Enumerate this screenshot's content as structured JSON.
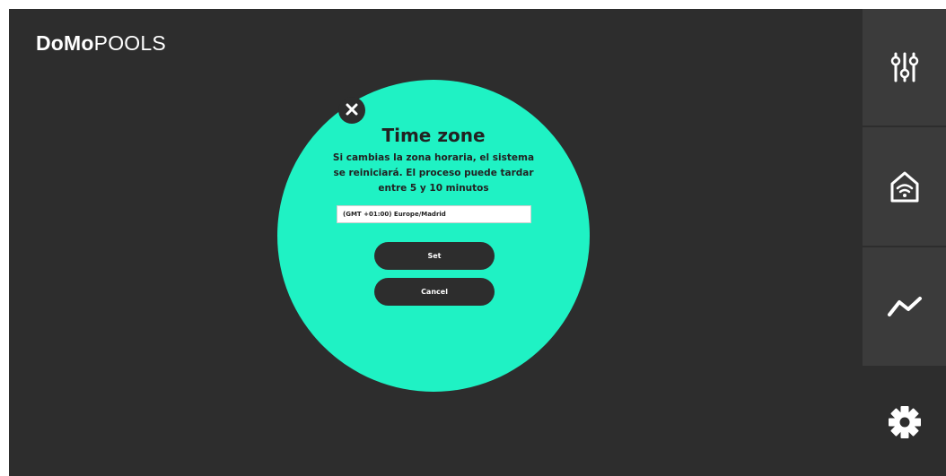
{
  "app": {
    "brand_bold": "DoMo",
    "brand_light": "POOLS"
  },
  "sidebar": {
    "items": [
      {
        "name": "settings-sliders",
        "icon": "sliders-icon"
      },
      {
        "name": "home-wifi",
        "icon": "home-wifi-icon"
      },
      {
        "name": "trends",
        "icon": "trend-line-icon"
      },
      {
        "name": "settings",
        "icon": "gear-icon"
      }
    ]
  },
  "modal": {
    "title": "Time zone",
    "message": "Si cambias la zona horaria, el sistema se reiniciará. El proceso puede tardar entre 5 y 10 minutos",
    "timezone_value": "(GMT +01:00) Europe/Madrid",
    "set_label": "Set",
    "cancel_label": "Cancel",
    "close_icon": "close-icon"
  },
  "colors": {
    "background": "#2d2d2d",
    "sidebar_panel": "#3b3b3b",
    "accent": "#1ff2c4",
    "button": "#2d2d2d"
  }
}
